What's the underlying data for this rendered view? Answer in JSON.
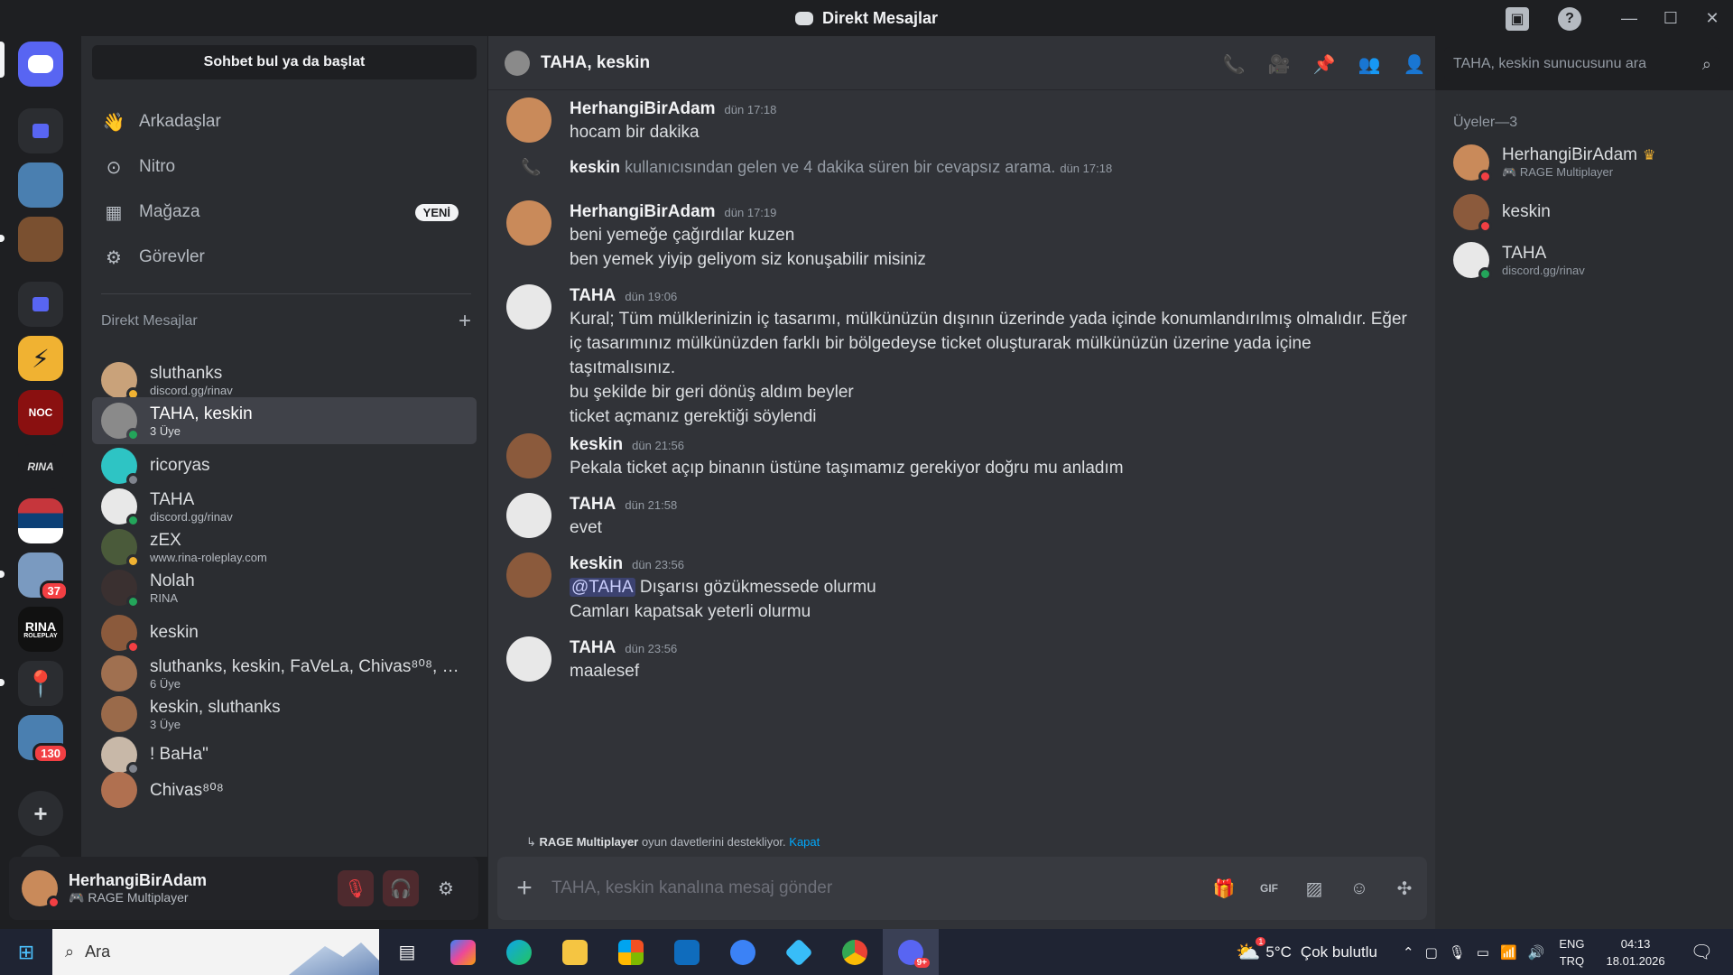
{
  "window": {
    "title": "Direkt Mesajlar"
  },
  "rail": {
    "badges": [
      "37",
      "130"
    ],
    "rina_label": "RINA",
    "rina_sub": "ROLEPLAY",
    "noc_label": "NOC"
  },
  "sidebar": {
    "find_button": "Sohbet bul ya da başlat",
    "nav": [
      {
        "label": "Arkadaşlar",
        "icon": "friends-icon"
      },
      {
        "label": "Nitro",
        "icon": "nitro-icon"
      },
      {
        "label": "Mağaza",
        "icon": "shop-icon",
        "badge": "YENİ"
      },
      {
        "label": "Görevler",
        "icon": "quests-icon"
      }
    ],
    "dm_header": "Direkt Mesajlar",
    "dms": [
      {
        "name": "sluthanks",
        "sub": "discord.gg/rinav",
        "status": "#f0b232",
        "color": "#c9a27a"
      },
      {
        "name": "TAHA, keskin",
        "sub": "3 Üye",
        "status": "#23a55a",
        "color": "#8a8a8a"
      },
      {
        "name": "ricoryas",
        "sub": "",
        "status": "#80848e",
        "color": "#2ec4c4"
      },
      {
        "name": "TAHA",
        "sub": "discord.gg/rinav",
        "status": "#23a55a",
        "color": "#e8e8e8"
      },
      {
        "name": "zEX",
        "sub": "www.rina-roleplay.com",
        "status": "#f0b232",
        "color": "#4a5a3a"
      },
      {
        "name": "Nolah",
        "sub": "RINA",
        "status": "#23a55a",
        "color": "#3a3030"
      },
      {
        "name": "keskin",
        "sub": "",
        "status": "#f23f43",
        "color": "#8b5a3c"
      },
      {
        "name": "sluthanks, keskin, FaVeLa, Chivas⁸⁰⁸, E...",
        "sub": "6 Üye",
        "status": "",
        "color": "#a07050"
      },
      {
        "name": "keskin, sluthanks",
        "sub": "3 Üye",
        "status": "",
        "color": "#9a6a4a"
      },
      {
        "name": "! BaHa\"",
        "sub": "",
        "status": "#80848e",
        "color": "#c8b8a8"
      },
      {
        "name": "Chivas⁸⁰⁸",
        "sub": "",
        "status": "",
        "color": "#b07050"
      }
    ]
  },
  "user": {
    "name": "HerhangiBirAdam",
    "activity": "RAGE Multiplayer"
  },
  "chat": {
    "title": "TAHA, keskin",
    "search_placeholder": "TAHA, keskin sunucusunu ara",
    "composer_placeholder": "TAHA, keskin kanalına mesaj gönder",
    "messages": [
      {
        "author": "HerhangiBirAdam",
        "time": "dün 17:18",
        "lines": [
          "hocam bir dakika"
        ]
      },
      {
        "author": "keskin",
        "system": "kullanıcısından gelen ve 4 dakika süren bir cevapsız arama.",
        "time": "dün 17:18"
      },
      {
        "author": "HerhangiBirAdam",
        "time": "dün 17:19",
        "lines": [
          "beni yemeğe çağırdılar kuzen",
          "ben yemek yiyip geliyom siz konuşabilir misiniz"
        ]
      },
      {
        "author": "TAHA",
        "time": "dün 19:06",
        "lines": [
          "Kural; Tüm mülklerinizin iç tasarımı, mülkünüzün dışının üzerinde yada içinde konumlandırılmış olmalıdır. Eğer iç tasarımınız mülkünüzden farklı bir bölgedeyse ticket oluşturarak mülkünüzün üzerine yada içine taşıtmalısınız.",
          "bu şekilde bir geri dönüş aldım beyler",
          "ticket açmanız gerektiği söylendi"
        ]
      },
      {
        "author": "keskin",
        "time": "dün 21:56",
        "lines": [
          "Pekala ticket açıp binanın üstüne taşımamız gerekiyor doğru mu anladım"
        ]
      },
      {
        "author": "TAHA",
        "time": "dün 21:58",
        "lines": [
          "evet"
        ]
      },
      {
        "author": "keskin",
        "time": "dün 23:56",
        "mention": "@TAHA",
        "lines": [
          "Dışarısı gözükmessede olurmu",
          "Camları kapatsak yeterli olurmu"
        ]
      },
      {
        "author": "TAHA",
        "time": "dün 23:56",
        "lines": [
          "maalesef"
        ]
      }
    ],
    "notice": {
      "app": "RAGE Multiplayer",
      "text": "oyun davetlerini destekliyor.",
      "link": "Kapat"
    }
  },
  "members": {
    "header": "Üyeler—3",
    "list": [
      {
        "name": "HerhangiBirAdam",
        "sub": "RAGE Multiplayer",
        "status": "#f23f43",
        "color": "#c98a5a",
        "owner": true
      },
      {
        "name": "keskin",
        "sub": "",
        "status": "#f23f43",
        "color": "#8b5a3c"
      },
      {
        "name": "TAHA",
        "sub": "discord.gg/rinav",
        "status": "#23a55a",
        "color": "#e8e8e8"
      }
    ]
  },
  "taskbar": {
    "search": "Ara",
    "weather_temp": "5°C",
    "weather_desc": "Çok bulutlu",
    "weather_badge": "1",
    "lang1": "ENG",
    "lang2": "TRQ",
    "time": "04:13",
    "date": "18.01.2026",
    "discord_badge": "9+"
  }
}
